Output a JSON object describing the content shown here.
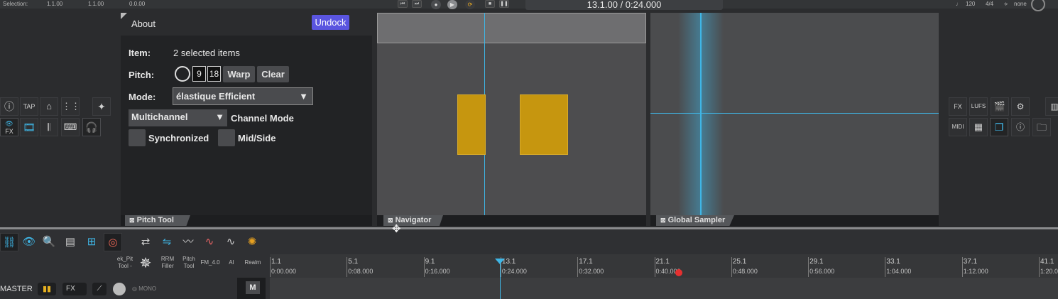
{
  "topbar": {
    "selection_label": "Selection:",
    "sel_start": "1.1.00",
    "sel_end": "1.1.00",
    "sel_len": "0.0.00",
    "time_display": "13.1.00 / 0:24.000",
    "tempo": "120",
    "timesig": "4/4",
    "snap": "none"
  },
  "left_toolbar": {
    "tap_label": "TAP",
    "fx_label": "FX"
  },
  "pitch_tool": {
    "about_label": "About",
    "undock_label": "Undock",
    "item_label": "Item:",
    "item_value": "2 selected items",
    "pitch_label": "Pitch:",
    "pitch_semitones": "9",
    "pitch_cents": "18",
    "warp_label": "Warp",
    "clear_label": "Clear",
    "mode_label": "Mode:",
    "mode_value": "élastique Efficient",
    "channel_value": "Multichannel",
    "channel_mode_label": "Channel Mode",
    "synchronized_label": "Synchronized",
    "midside_label": "Mid/Side",
    "tab_label": "Pitch Tool"
  },
  "navigator": {
    "tab_label": "Navigator"
  },
  "global_sampler": {
    "tab_label": "Global Sampler"
  },
  "right_toolbar": {
    "fx_label": "FX",
    "lufs_label": "LUFS",
    "midi_label": "MIDI"
  },
  "bottom_toolbar": {
    "items": [
      {
        "label": "ek_Pit\nTool -"
      },
      {
        "label": "RRM\nFiller"
      },
      {
        "label": "Pitch\nTool"
      },
      {
        "label": "FM_4.0"
      },
      {
        "label": "AI"
      },
      {
        "label": "Realm"
      }
    ]
  },
  "master": {
    "label": "MASTER",
    "fx_label": "FX",
    "mono_label": "MONO",
    "m_label": "M"
  },
  "ruler": {
    "markers": [
      {
        "bar": "1.1",
        "time": "0:00.000"
      },
      {
        "bar": "5.1",
        "time": "0:08.000"
      },
      {
        "bar": "9.1",
        "time": "0:16.000"
      },
      {
        "bar": "13.1",
        "time": "0:24.000"
      },
      {
        "bar": "17.1",
        "time": "0:32.000"
      },
      {
        "bar": "21.1",
        "time": "0:40.000"
      },
      {
        "bar": "25.1",
        "time": "0:48.000"
      },
      {
        "bar": "29.1",
        "time": "0:56.000"
      },
      {
        "bar": "33.1",
        "time": "1:04.000"
      },
      {
        "bar": "37.1",
        "time": "1:12.000"
      },
      {
        "bar": "41.1",
        "time": "1:20.0"
      }
    ]
  },
  "colors": {
    "accent": "#3fb6e6",
    "item_fill": "#c6960f",
    "undock_bg": "#5a55e0"
  }
}
